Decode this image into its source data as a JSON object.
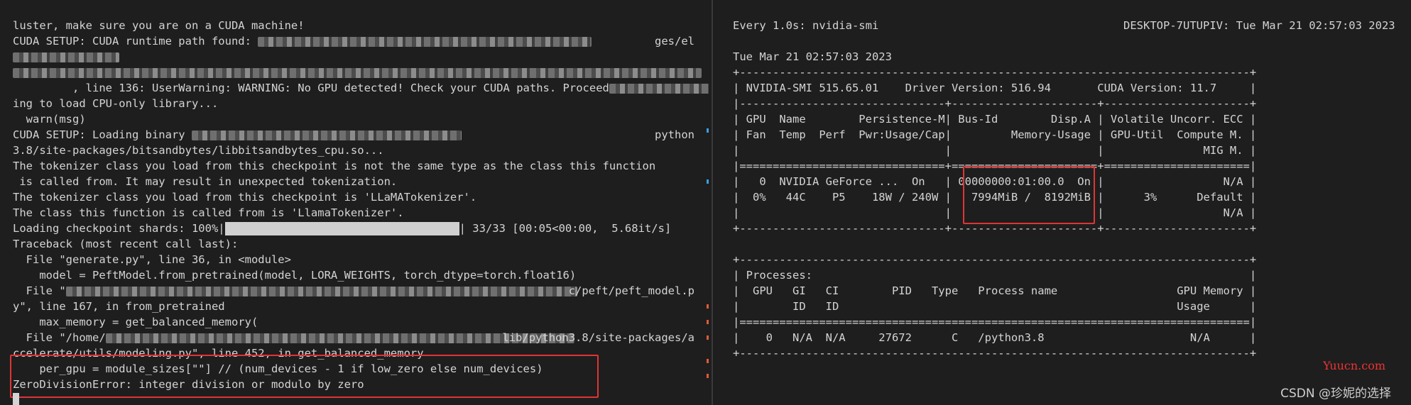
{
  "left_terminal": {
    "lines": [
      "luster, make sure you are on a CUDA machine!",
      "CUDA SETUP: CUDA runtime path found: ",
      "",
      "",
      "         , line 136: UserWarning: WARNING: No GPU detected! Check your CUDA paths. Proceed",
      "ing to load CPU-only library...",
      "  warn(msg)",
      "CUDA SETUP: Loading binary ",
      "3.8/site-packages/bitsandbytes/libbitsandbytes_cpu.so...",
      "The tokenizer class you load from this checkpoint is not the same type as the class this function",
      " is called from. It may result in unexpected tokenization.",
      "The tokenizer class you load from this checkpoint is 'LLaMATokenizer'.",
      "The class this function is called from is 'LlamaTokenizer'.",
      "Loading checkpoint shards: 100%|",
      "Traceback (most recent call last):",
      "  File \"generate.py\", line 36, in <module>",
      "    model = PeftModel.from_pretrained(model, LORA_WEIGHTS, torch_dtype=torch.float16)",
      "  File \"",
      "y\", line 167, in from_pretrained",
      "    max_memory = get_balanced_memory(",
      "  File \"/home/",
      "ccelerate/utils/modeling.py\", line 452, in get_balanced_memory",
      "    per_gpu = module_sizes[\"\"] // (num_devices - 1 if low_zero else num_devices)",
      "ZeroDivisionError: integer division or modulo by zero"
    ],
    "tails": {
      "1": "ges/el",
      "7": "python",
      "13": "| 33/33 [00:05<00:00,  5.68it/s]",
      "17": "c/peft/peft_model.p",
      "20": "lib/python3.8/site-packages/a"
    }
  },
  "right_terminal": {
    "header_left": "Every 1.0s: nvidia-smi",
    "header_right": "DESKTOP-7UTUPIV: Tue Mar 21 02:57:03 2023",
    "date_line": "Tue Mar 21 02:57:03 2023",
    "lines": [
      "+-----------------------------------------------------------------------------+",
      "| NVIDIA-SMI 515.65.01    Driver Version: 516.94       CUDA Version: 11.7     |",
      "|-------------------------------+----------------------+----------------------+",
      "| GPU  Name        Persistence-M| Bus-Id        Disp.A | Volatile Uncorr. ECC |",
      "| Fan  Temp  Perf  Pwr:Usage/Cap|         Memory-Usage | GPU-Util  Compute M. |",
      "|                               |                      |               MIG M. |",
      "|===============================+======================+======================|",
      "|   0  NVIDIA GeForce ...  On   | 00000000:01:00.0  On |                  N/A |",
      "|  0%   44C    P5    18W / 240W |   7994MiB /  8192MiB |      3%      Default |",
      "|                               |                      |                  N/A |",
      "+-------------------------------+----------------------+----------------------+",
      "",
      "+-----------------------------------------------------------------------------+",
      "| Processes:                                                                  |",
      "|  GPU   GI   CI        PID   Type   Process name                  GPU Memory |",
      "|        ID   ID                                                   Usage      |",
      "|=============================================================================|",
      "|    0   N/A  N/A     27672      C   /python3.8                      N/A      |",
      "+-----------------------------------------------------------------------------+"
    ]
  },
  "watermark": "Yuucn.com",
  "credit": "CSDN @珍妮的选择",
  "colors": {
    "background": "#1e1e1e",
    "text": "#d4d4d4",
    "highlight": "#e03535"
  }
}
